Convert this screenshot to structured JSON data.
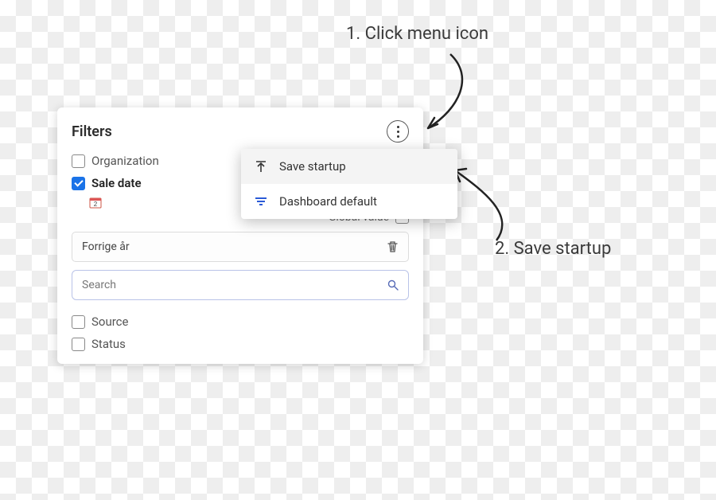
{
  "annotations": {
    "step1": "1. Click menu icon",
    "step2": "2. Save startup"
  },
  "panel": {
    "title": "Filters",
    "global_value_label": "Global value"
  },
  "filters": {
    "organization": {
      "label": "Organization",
      "checked": false
    },
    "sale_date": {
      "label": "Sale date",
      "checked": true
    },
    "source": {
      "label": "Source",
      "checked": false
    },
    "status": {
      "label": "Status",
      "checked": false
    }
  },
  "sale_date": {
    "chip_value": "Forrige år",
    "search_placeholder": "Search",
    "global_value_checked": false
  },
  "menu": {
    "items": [
      {
        "id": "save-startup",
        "label": "Save startup",
        "hover": true
      },
      {
        "id": "dashboard-default",
        "label": "Dashboard default",
        "hover": false
      }
    ]
  }
}
